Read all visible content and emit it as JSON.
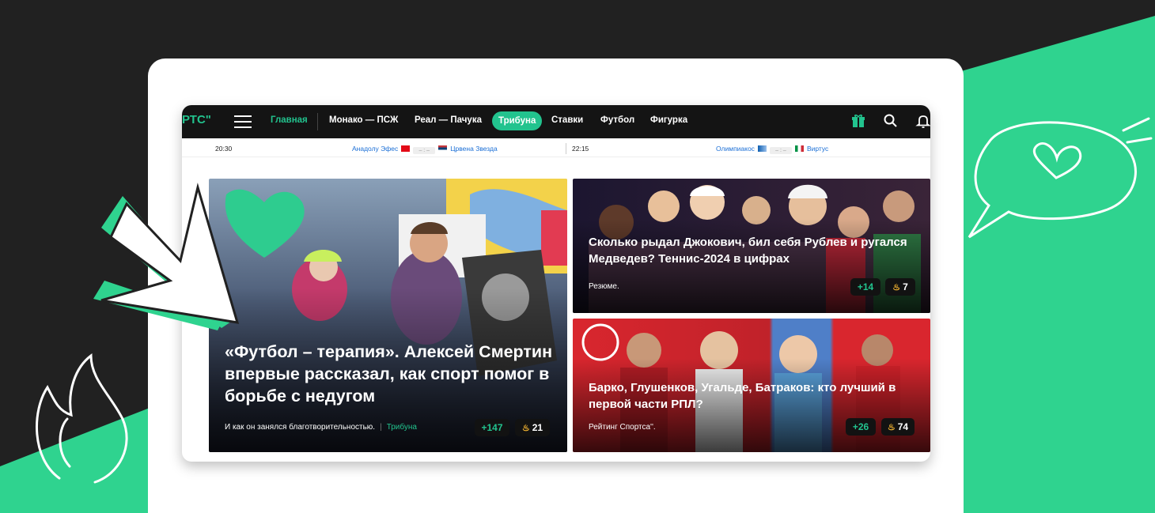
{
  "colors": {
    "accent": "#22c38e",
    "dark": "#212121",
    "card": "#ffffff"
  },
  "logo": "РТС\"",
  "nav": {
    "items": [
      "Главная",
      "Монако — ПСЖ",
      "Реал — Пачука",
      "Трибуна",
      "Ставки",
      "Футбол",
      "Фигурка"
    ],
    "active": "Главная",
    "highlighted": "Трибуна"
  },
  "icons": [
    "menu-icon",
    "gift-icon",
    "search-icon",
    "bell-icon"
  ],
  "scores": [
    {
      "time": "20:30",
      "home": "Анадолу Эфес",
      "away": "Црвена Звезда",
      "score": "– : –"
    },
    {
      "time": "22:15",
      "home": "Олимпиакос",
      "away": "Виртус",
      "score": "– : –"
    }
  ],
  "cards": {
    "main": {
      "title": "«Футбол – терапия». Алексей Смертин впервые рассказал, как спорт помог в борьбе с недугом",
      "subtitle": "И как он занялся благотворительностью.",
      "tag": "Трибуна",
      "plus": "+147",
      "fire": "21"
    },
    "top_right": {
      "title": "Сколько рыдал Джокович, бил себя Рублев и ругался Медведев? Теннис-2024 в цифрах",
      "subtitle": "Резюме.",
      "plus": "+14",
      "fire": "7"
    },
    "bottom_right": {
      "title": "Барко, Глушенков, Угальде, Батраков: кто лучший в первой части РПЛ?",
      "subtitle": "Рейтинг Спортса''.",
      "plus": "+26",
      "fire": "74"
    }
  }
}
